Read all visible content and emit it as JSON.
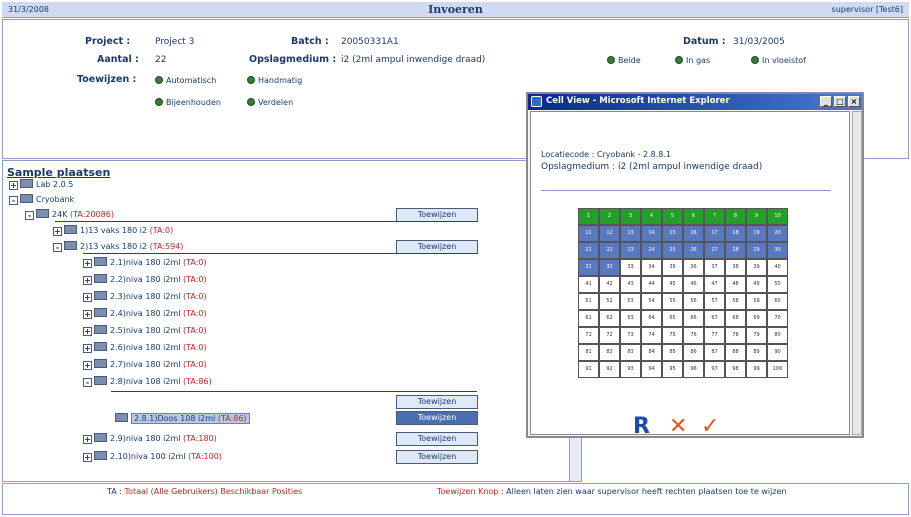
{
  "topbar": {
    "date": "31/3/2008",
    "title": "Invoeren",
    "user": "supervisor [Test6]"
  },
  "header": {
    "project_label": "Project :",
    "project_value": "Project 3",
    "batch_label": "Batch :",
    "batch_value": "20050331A1",
    "datum_label": "Datum :",
    "datum_value": "31/03/2005",
    "aantal_label": "Aantal :",
    "aantal_value": "22",
    "opslag_label": "Opslagmedium :",
    "opslag_value": "i2 (2ml ampul inwendige draad)",
    "opslag_options": [
      "Beide",
      "In gas",
      "In vloeistof"
    ],
    "toewijzen_label": "Toewijzen :",
    "toewijzen_options": [
      "Automatisch",
      "Handmatig",
      "Bijeenhouden",
      "Verdelen"
    ]
  },
  "tree": {
    "title": "Sample plaatsen",
    "rows": [
      {
        "text": "Lab 2.0.5",
        "red": ""
      },
      {
        "text": "Cryobank",
        "red": ""
      },
      {
        "text": "24K ",
        "red": "(TA:20086)",
        "btn": "Toewijzen"
      },
      {
        "text": "1)13 vaks 180 i2 ",
        "red": "(TA:0)"
      },
      {
        "text": "2)13 vaks 180 i2 ",
        "red": "(TA:594)",
        "btn": "Toewijzen"
      },
      {
        "text": "2.1)niva 180 i2ml ",
        "red": "(TA:0)"
      },
      {
        "text": "2.2)niva 180 i2ml ",
        "red": "(TA:0)"
      },
      {
        "text": "2.3)niva 180 i2ml ",
        "red": "(TA:0)"
      },
      {
        "text": "2.4)niva 180 i2ml ",
        "red": "(TA:0)"
      },
      {
        "text": "2.5)niva 180 i2ml ",
        "red": "(TA:0)"
      },
      {
        "text": "2.6)niva 180 i2ml ",
        "red": "(TA:0)"
      },
      {
        "text": "2.7)niva 180 i2ml ",
        "red": "(TA:0)"
      },
      {
        "text": "2.8)niva 108 i2ml ",
        "red": "(TA:86)",
        "btn": "Toewijzen"
      },
      {
        "text": "2.8.1)Doos 108 i2ml ",
        "red": "(TA:86)",
        "btn": "Toewijzen"
      },
      {
        "text": "2.9)niva 180 i2ml ",
        "red": "(TA:180)",
        "btn": "Toewijzen"
      },
      {
        "text": "2.10)niva 100 i2ml ",
        "red": "(TA:100)",
        "btn": "Toewijzen"
      }
    ]
  },
  "footer": {
    "ta_label": "TA : ",
    "ta_text": "Totaal (Alle Gebruikers) Beschikbaar Posities",
    "knop_label": "Toewijzen Knop : ",
    "knop_text": "Alleen laten zien waar supervisor heeft rechten plaatsen toe te wijzen"
  },
  "popup": {
    "title": "Cell View - Microsoft Internet Explorer",
    "locatiecode": "Locatiecode : Cryobank - 2.8.8.1",
    "opslagmedium": "Opslagmedium : i2 (2ml ampul inwendige draad)",
    "btn_r": "R",
    "btn_x": "✕",
    "btn_ok": "✓",
    "grid_green": 10,
    "grid_blue": 32,
    "grid_total": 100
  }
}
